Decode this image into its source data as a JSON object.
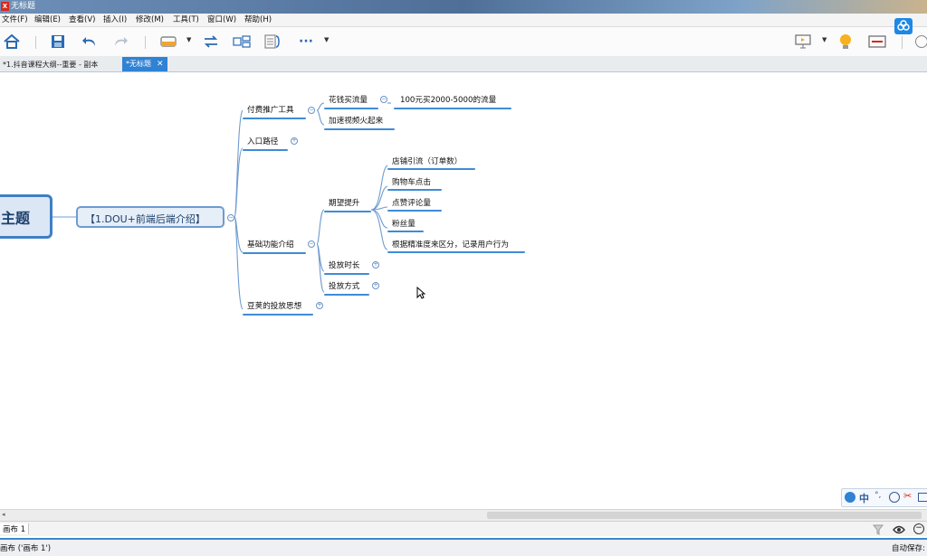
{
  "window": {
    "title": "无标题",
    "logo_text": "X"
  },
  "menu": [
    {
      "label": "文件(F)"
    },
    {
      "label": "编辑(E)"
    },
    {
      "label": "查看(V)"
    },
    {
      "label": "插入(I)"
    },
    {
      "label": "修改(M)"
    },
    {
      "label": "工具(T)"
    },
    {
      "label": "窗口(W)"
    },
    {
      "label": "帮助(H)"
    }
  ],
  "toolbar": {
    "home": "⌂",
    "save": "💾",
    "undo": "↶",
    "redo": "↷",
    "more": "···",
    "light": "💡"
  },
  "tabs": [
    {
      "label": "*1.抖音课程大纲--重要 - 副本",
      "active": false
    },
    {
      "label": "*无标题",
      "active": true,
      "close": "✕"
    }
  ],
  "mindmap": {
    "root": "主题",
    "center": "【1.DOU+前端后端介绍】",
    "branches": {
      "paid_tools": "付费推广工具",
      "buy_traffic": "花钱买流量",
      "buy_traffic_detail": "100元买2000-5000的流量",
      "video_hot": "加速视频火起来",
      "entry_path": "入口路径",
      "basic_features": "基础功能介绍",
      "expect_boost": "期望提升",
      "shop_traffic": "店铺引流（订单数）",
      "cart_click": "购物车点击",
      "likes_comments": "点赞评论量",
      "followers": "粉丝量",
      "precision": "根据精准度来区分，记录用户行为",
      "duration": "投放时长",
      "method": "投放方式",
      "doujia": "豆荚的投放思想"
    },
    "toggle_minus": "−",
    "toggle_plus": "+"
  },
  "sheet": {
    "tab": "画布 1"
  },
  "status": {
    "left": "画布 ('画布 1')",
    "right": "自动保存: 开"
  },
  "ime": {
    "lang": "中",
    "punct": "°,"
  },
  "colors": {
    "accent": "#3f8bd6",
    "root_border": "#3f7fc6",
    "root_fill": "#dbe7f5"
  }
}
